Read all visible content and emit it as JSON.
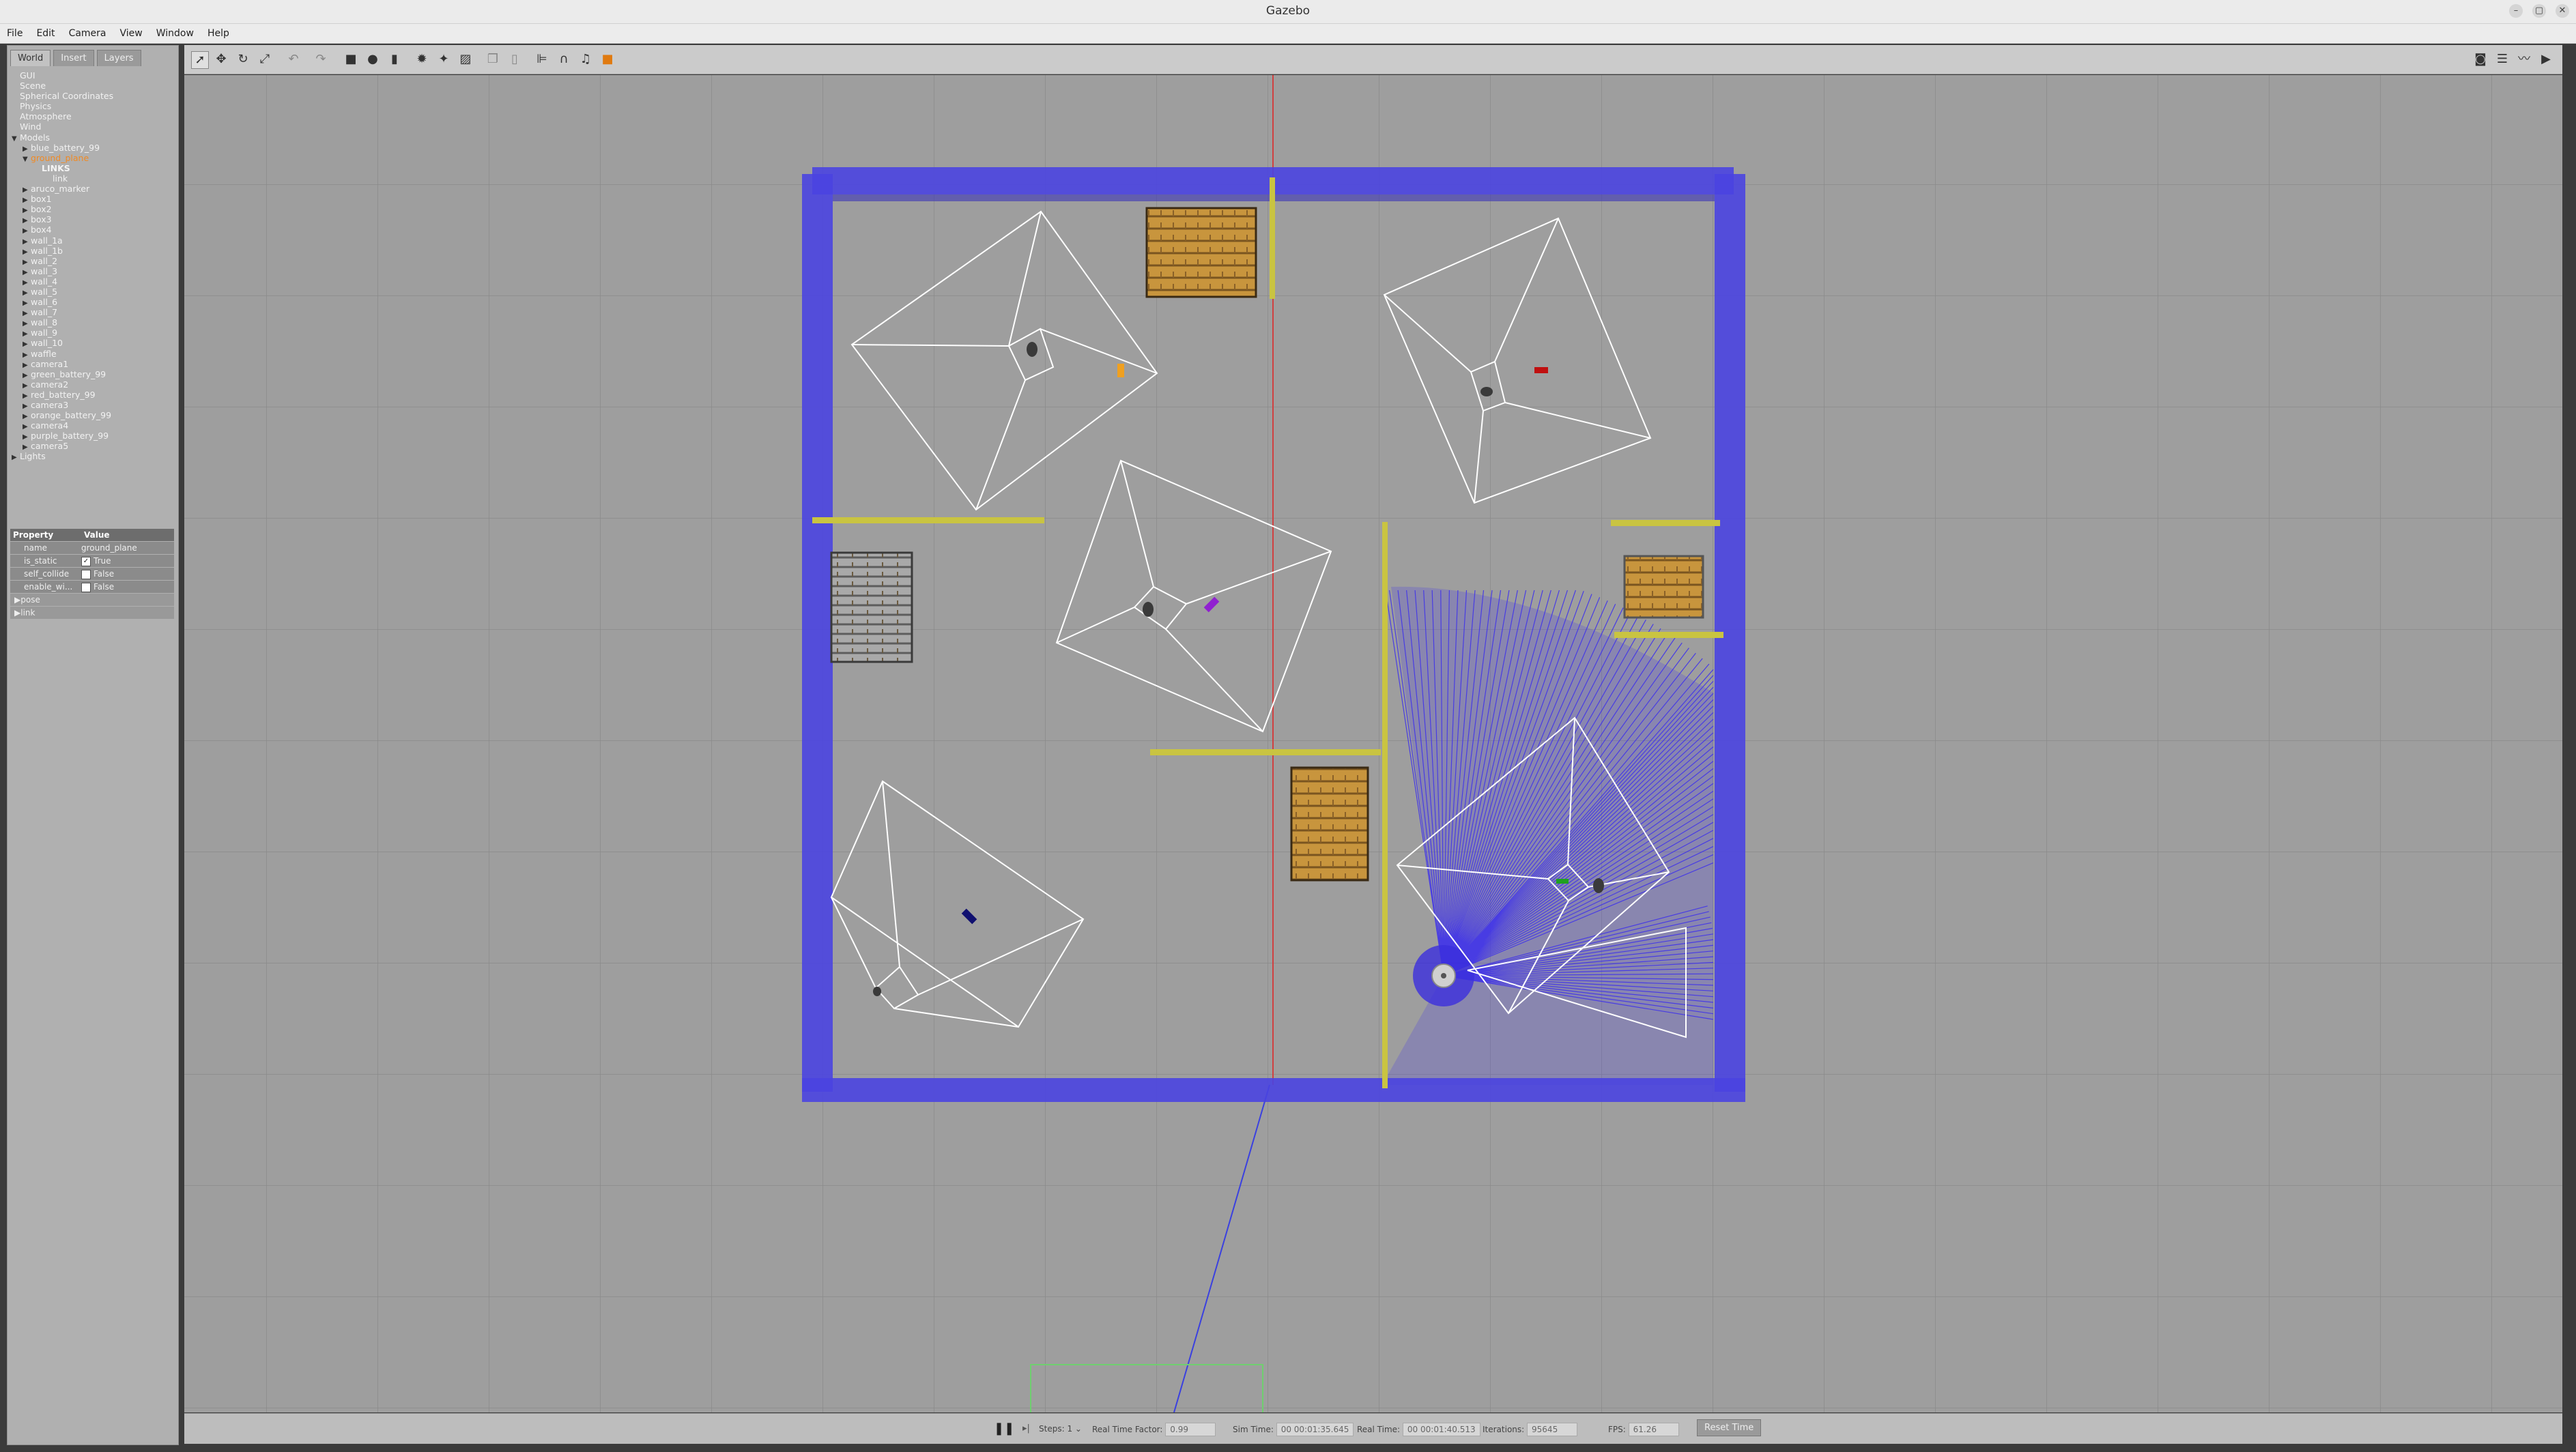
{
  "window": {
    "title": "Gazebo",
    "controls": [
      "–",
      "▢",
      "✕"
    ]
  },
  "menu": [
    "File",
    "Edit",
    "Camera",
    "View",
    "Window",
    "Help"
  ],
  "sidebar": {
    "tabs": [
      "World",
      "Insert",
      "Layers"
    ],
    "tree": [
      {
        "label": "GUI",
        "indent": 0,
        "arrow": ""
      },
      {
        "label": "Scene",
        "indent": 0,
        "arrow": ""
      },
      {
        "label": "Spherical Coordinates",
        "indent": 0,
        "arrow": ""
      },
      {
        "label": "Physics",
        "indent": 0,
        "arrow": ""
      },
      {
        "label": "Atmosphere",
        "indent": 0,
        "arrow": ""
      },
      {
        "label": "Wind",
        "indent": 0,
        "arrow": ""
      },
      {
        "label": "Models",
        "indent": 0,
        "arrow": "▼"
      },
      {
        "label": "blue_battery_99",
        "indent": 1,
        "arrow": "▶"
      },
      {
        "label": "ground_plane",
        "indent": 1,
        "arrow": "▼",
        "selected": true
      },
      {
        "label": "LINKS",
        "indent": 2,
        "arrow": "",
        "bold": true
      },
      {
        "label": "link",
        "indent": 3,
        "arrow": ""
      },
      {
        "label": "aruco_marker",
        "indent": 1,
        "arrow": "▶"
      },
      {
        "label": "box1",
        "indent": 1,
        "arrow": "▶"
      },
      {
        "label": "box2",
        "indent": 1,
        "arrow": "▶"
      },
      {
        "label": "box3",
        "indent": 1,
        "arrow": "▶"
      },
      {
        "label": "box4",
        "indent": 1,
        "arrow": "▶"
      },
      {
        "label": "wall_1a",
        "indent": 1,
        "arrow": "▶"
      },
      {
        "label": "wall_1b",
        "indent": 1,
        "arrow": "▶"
      },
      {
        "label": "wall_2",
        "indent": 1,
        "arrow": "▶"
      },
      {
        "label": "wall_3",
        "indent": 1,
        "arrow": "▶"
      },
      {
        "label": "wall_4",
        "indent": 1,
        "arrow": "▶"
      },
      {
        "label": "wall_5",
        "indent": 1,
        "arrow": "▶"
      },
      {
        "label": "wall_6",
        "indent": 1,
        "arrow": "▶"
      },
      {
        "label": "wall_7",
        "indent": 1,
        "arrow": "▶"
      },
      {
        "label": "wall_8",
        "indent": 1,
        "arrow": "▶"
      },
      {
        "label": "wall_9",
        "indent": 1,
        "arrow": "▶"
      },
      {
        "label": "wall_10",
        "indent": 1,
        "arrow": "▶"
      },
      {
        "label": "waffle",
        "indent": 1,
        "arrow": "▶"
      },
      {
        "label": "camera1",
        "indent": 1,
        "arrow": "▶"
      },
      {
        "label": "green_battery_99",
        "indent": 1,
        "arrow": "▶"
      },
      {
        "label": "camera2",
        "indent": 1,
        "arrow": "▶"
      },
      {
        "label": "red_battery_99",
        "indent": 1,
        "arrow": "▶"
      },
      {
        "label": "camera3",
        "indent": 1,
        "arrow": "▶"
      },
      {
        "label": "orange_battery_99",
        "indent": 1,
        "arrow": "▶"
      },
      {
        "label": "camera4",
        "indent": 1,
        "arrow": "▶"
      },
      {
        "label": "purple_battery_99",
        "indent": 1,
        "arrow": "▶"
      },
      {
        "label": "camera5",
        "indent": 1,
        "arrow": "▶"
      },
      {
        "label": "Lights",
        "indent": 0,
        "arrow": "▶"
      }
    ],
    "properties": {
      "header_property": "Property",
      "header_value": "Value",
      "rows": [
        {
          "key": "name",
          "value": "ground_plane",
          "checkbox": false
        },
        {
          "key": "is_static",
          "value": "True",
          "checkbox": true,
          "checked": true
        },
        {
          "key": "self_collide",
          "value": "False",
          "checkbox": true,
          "checked": false
        },
        {
          "key": "enable_wi...",
          "value": "False",
          "checkbox": true,
          "checked": false
        }
      ],
      "groups": [
        "pose",
        "link"
      ]
    }
  },
  "toolbar": {
    "tools": [
      "select-tool-icon",
      "translate-tool-icon",
      "rotate-tool-icon",
      "scale-tool-icon",
      "undo-icon",
      "redo-icon",
      "box-shape-icon",
      "sphere-shape-icon",
      "cylinder-shape-icon",
      "point-light-icon",
      "spot-light-icon",
      "directional-light-icon",
      "copy-icon",
      "paste-icon",
      "align-icon",
      "snap-icon",
      "audio-icon",
      "view-angle-icon"
    ],
    "right_tools": [
      "screenshot-icon",
      "log-icon",
      "plot-icon",
      "video-record-icon"
    ]
  },
  "bottom": {
    "steps_label": "Steps:",
    "steps_value": "1",
    "real_time_factor_label": "Real Time Factor:",
    "real_time_factor_value": "0.99",
    "sim_time_label": "Sim Time:",
    "sim_time_value": "00 00:01:35.645",
    "real_time_label": "Real Time:",
    "real_time_value": "00 00:01:40.513",
    "iterations_label": "Iterations:",
    "iterations_value": "95645",
    "fps_label": "FPS:",
    "fps_value": "61.26",
    "reset_label": "Reset Time"
  },
  "colors": {
    "ground": "#9e9e9e",
    "grid": "#8a8a8a",
    "outer_wall": "#4a44e0",
    "inner_wall": "#c9c441",
    "camera_frustum": "#ffffff",
    "laser": "#3a2cf0",
    "selected_tree": "#f08a24"
  },
  "scene": {
    "batteries": [
      "orange",
      "red",
      "purple",
      "blue",
      "green"
    ]
  }
}
